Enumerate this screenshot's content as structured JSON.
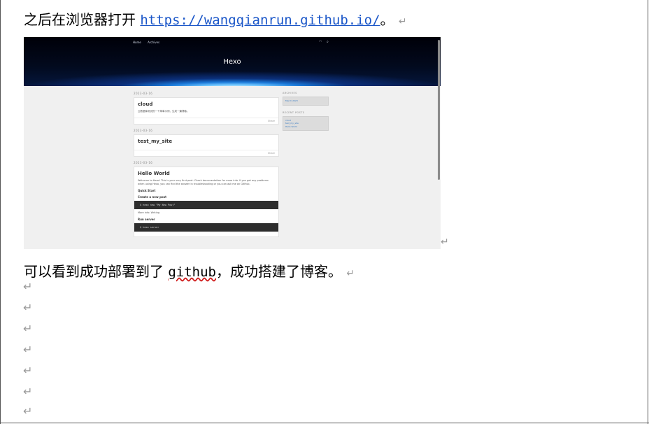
{
  "doc": {
    "line1_text": "之后在浏览器打开 ",
    "line1_link": "https://wangqianrun.github.io/",
    "line1_end": "。",
    "line2_pre": "可以看到成功部署到了 ",
    "line2_word": "github",
    "line2_post": "，成功搭建了博客。",
    "para_mark": "↵"
  },
  "screenshot": {
    "nav_items": [
      "Home",
      "Archives"
    ],
    "site_title": "Hexo",
    "posts": [
      {
        "date": "2023-03-16",
        "title": "cloud",
        "excerpt": "云数据库测试的一个简单示例，生成一篇博客。",
        "footer": "Share"
      },
      {
        "date": "2023-03-16",
        "title": "test_my_site",
        "footer": "Share"
      },
      {
        "date": "2023-03-16",
        "title": "Hello World",
        "excerpt": "Welcome to Hexo! This is your very first post. Check documentation for more info. If you get any problems when using Hexo, you can find the answer in troubleshooting or you can ask me on GitHub.",
        "sub1": "Quick Start",
        "sub2": "Create a new post",
        "code1": "$ hexo new \"My New Post\"",
        "more": "More info: Writing",
        "sub3": "Run server",
        "code2": "$ hexo server"
      }
    ],
    "sidebar": {
      "archives_heading": "ARCHIVES",
      "archives_item": "March 2023",
      "recent_heading": "RECENT POSTS",
      "recent_items": [
        "cloud",
        "test_my_site",
        "Hello World"
      ]
    }
  }
}
